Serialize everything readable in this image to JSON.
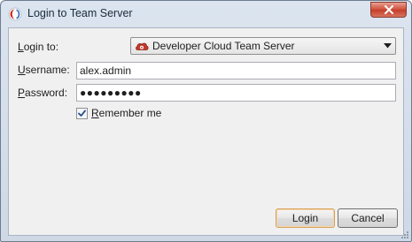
{
  "window": {
    "title": "Login to Team Server",
    "close_symbol": "✕"
  },
  "form": {
    "login_to": {
      "label_accel": "L",
      "label_rest": "ogin to:",
      "selected": "Developer Cloud Team Server",
      "icon": "cloud-server-icon"
    },
    "username": {
      "label_accel": "U",
      "label_rest": "sername:",
      "value": "alex.admin"
    },
    "password": {
      "label_accel": "P",
      "label_rest": "assword:",
      "masked_value": "●●●●●●●●●"
    },
    "remember": {
      "label_accel": "R",
      "label_rest": "emember me",
      "checked": true
    }
  },
  "buttons": {
    "login": "Login",
    "cancel": "Cancel"
  },
  "colors": {
    "accent": "#d6a05a",
    "close": "#c33e29",
    "cloud_icon": "#c0392b"
  }
}
